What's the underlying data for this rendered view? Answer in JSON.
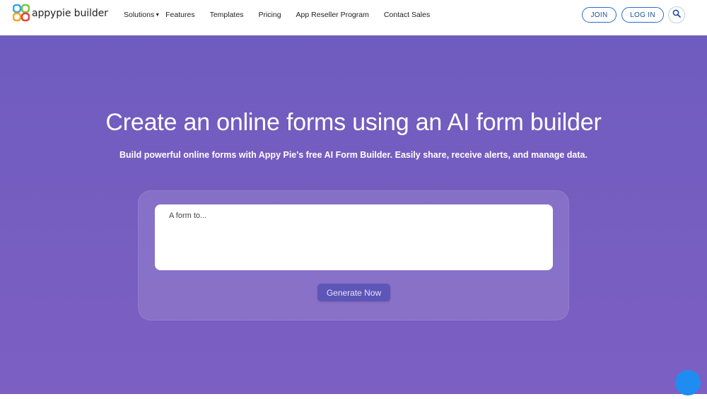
{
  "brand": {
    "name": "appypie builder"
  },
  "nav": {
    "items": [
      {
        "label": "Solutions",
        "has_dropdown": true
      },
      {
        "label": "Features"
      },
      {
        "label": "Templates"
      },
      {
        "label": "Pricing"
      },
      {
        "label": "App Reseller Program"
      },
      {
        "label": "Contact Sales"
      }
    ],
    "join_label": "JOIN",
    "login_label": "LOG IN"
  },
  "hero": {
    "title": "Create an online forms using an AI form builder",
    "subtitle": "Build powerful online forms with Appy Pie's free AI Form Builder. Easily share, receive alerts, and manage data.",
    "input_placeholder": "A form to...",
    "input_value": "",
    "generate_label": "Generate Now"
  },
  "icons": {
    "search": "search-icon",
    "chat": "chat-icon",
    "logo": "appypie-logo-icon"
  },
  "colors": {
    "hero_bg": "#7360c0",
    "accent_blue": "#2a6ad4",
    "generate_btn": "#5d56b8",
    "chat_bubble": "#1f8cf2"
  }
}
